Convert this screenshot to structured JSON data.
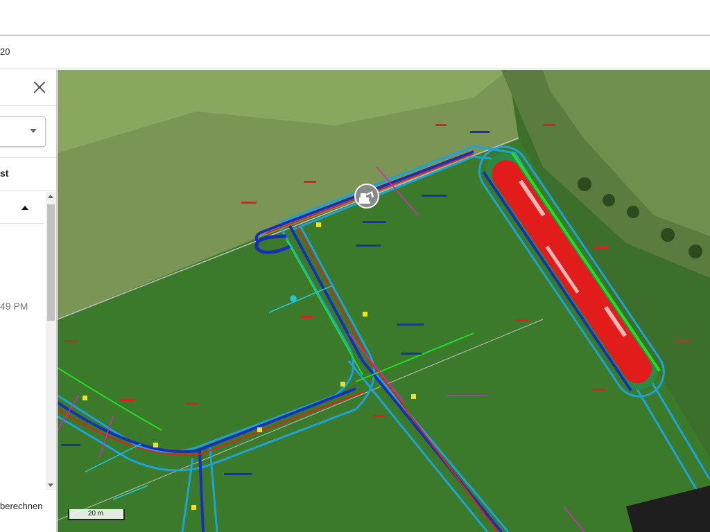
{
  "header": {
    "subbar_text": "20"
  },
  "panel": {
    "section_title": "st",
    "time_text": "49 PM",
    "recalc_text": "berechnen"
  },
  "map": {
    "scale_label": "20 m",
    "icons": {
      "close": "close-icon",
      "marker": "excavator-icon"
    }
  }
}
